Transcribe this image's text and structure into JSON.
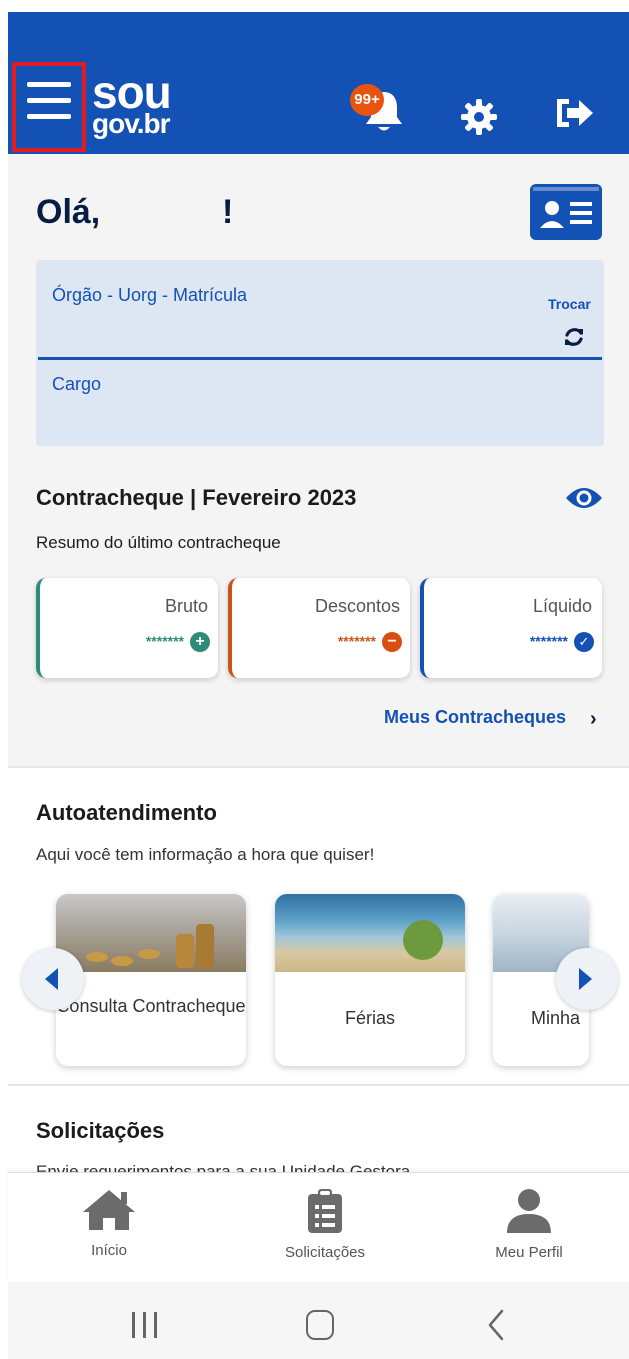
{
  "header": {
    "logo_line1": "sou",
    "logo_line2": "gov.br",
    "notification_badge": "99+",
    "colors": {
      "brand_blue": "#1351b4",
      "badge_orange": "#e8540e",
      "highlight_red": "#e01b24"
    }
  },
  "greeting": {
    "hello": "Olá,",
    "exclamation": "!"
  },
  "org_card": {
    "org_label": "Órgão - Uorg - Matrícula",
    "switch_label": "Trocar",
    "cargo_label": "Cargo"
  },
  "paycheck": {
    "title": "Contracheque | Fevereiro 2023",
    "subtitle": "Resumo do último contracheque",
    "cards": [
      {
        "label": "Bruto",
        "value": "*******",
        "icon": "plus-circle-icon",
        "color": "#2e8b7a"
      },
      {
        "label": "Descontos",
        "value": "*******",
        "icon": "minus-circle-icon",
        "color": "#c9541a"
      },
      {
        "label": "Líquido",
        "value": "*******",
        "icon": "check-circle-icon",
        "color": "#1351b4"
      }
    ],
    "link_label": "Meus Contracheques",
    "link_chevron": "›"
  },
  "self_service": {
    "title": "Autoatendimento",
    "subtitle": "Aqui você tem informação a hora que quiser!",
    "tiles": [
      {
        "label": "Consulta Contracheque"
      },
      {
        "label": "Férias"
      },
      {
        "label": "Minha"
      }
    ]
  },
  "requests": {
    "title": "Solicitações",
    "subtitle": "Envie requerimentos para a sua Unidade Gestora"
  },
  "bottom_nav": {
    "items": [
      {
        "label": "Início",
        "icon": "home-icon"
      },
      {
        "label": "Solicitações",
        "icon": "clipboard-list-icon"
      },
      {
        "label": "Meu Perfil",
        "icon": "user-icon"
      }
    ]
  }
}
